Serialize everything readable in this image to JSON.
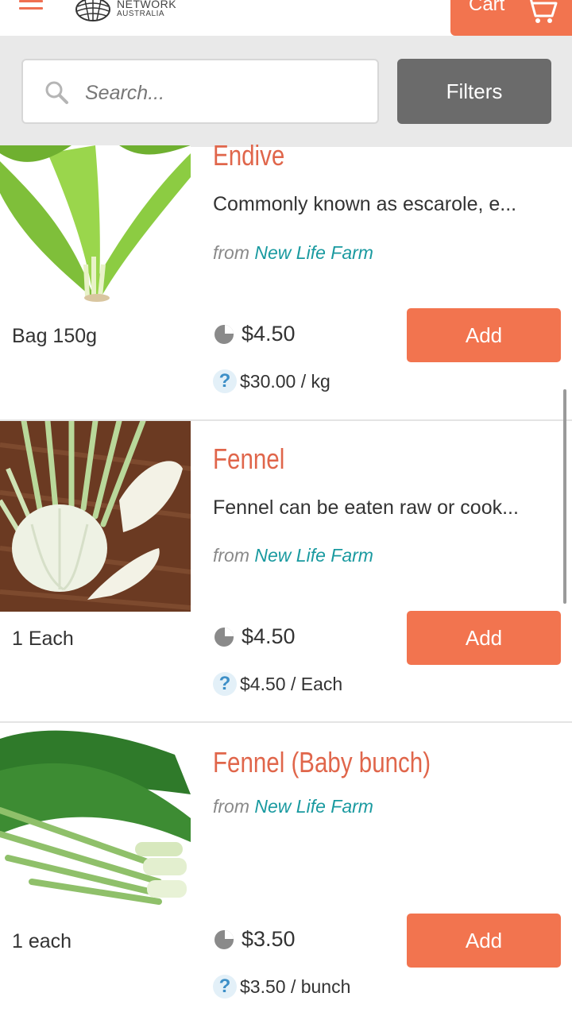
{
  "header": {
    "logo_line1": "NETWORK",
    "logo_line2": "AUSTRALIA",
    "cart_label": "Cart",
    "accent_color": "#f2744f"
  },
  "search": {
    "placeholder": "Search...",
    "value": "",
    "filters_label": "Filters"
  },
  "products": [
    {
      "name": "Endive",
      "description": "Commonly known as escarole, e...",
      "source_prefix": "from",
      "farm": "New Life Farm",
      "unit": "Bag 150g",
      "price": "$4.50",
      "unit_price": "$30.00 / kg",
      "add_label": "Add"
    },
    {
      "name": "Fennel",
      "description": "Fennel can be eaten raw or cook...",
      "source_prefix": "from",
      "farm": "New Life Farm",
      "unit": "1 Each",
      "price": "$4.50",
      "unit_price": "$4.50 / Each",
      "add_label": "Add"
    },
    {
      "name": "Fennel (Baby bunch)",
      "source_prefix": "from",
      "farm": "New Life Farm",
      "unit": "1 each",
      "price": "$3.50",
      "unit_price": "$3.50 / bunch",
      "add_label": "Add"
    }
  ]
}
